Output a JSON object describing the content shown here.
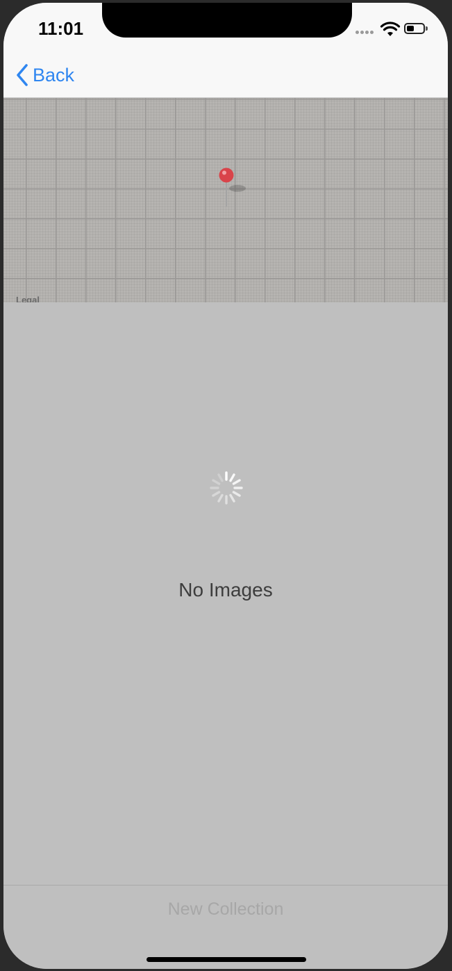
{
  "status_bar": {
    "time": "11:01",
    "icons": [
      "cellular-signal-icon",
      "wifi-icon",
      "battery-icon"
    ]
  },
  "nav_bar": {
    "back_label": "Back",
    "back_icon": "chevron-left-icon"
  },
  "map": {
    "legal_label": "Legal",
    "pin_icon": "map-pin-icon",
    "pin_color": "#d9444a"
  },
  "content": {
    "loading_indicator": "spinner-icon",
    "empty_message": "No Images"
  },
  "toolbar": {
    "new_collection_label": "New Collection"
  },
  "colors": {
    "accent": "#2f86f0",
    "overlay_background": "#bfbfbf"
  }
}
